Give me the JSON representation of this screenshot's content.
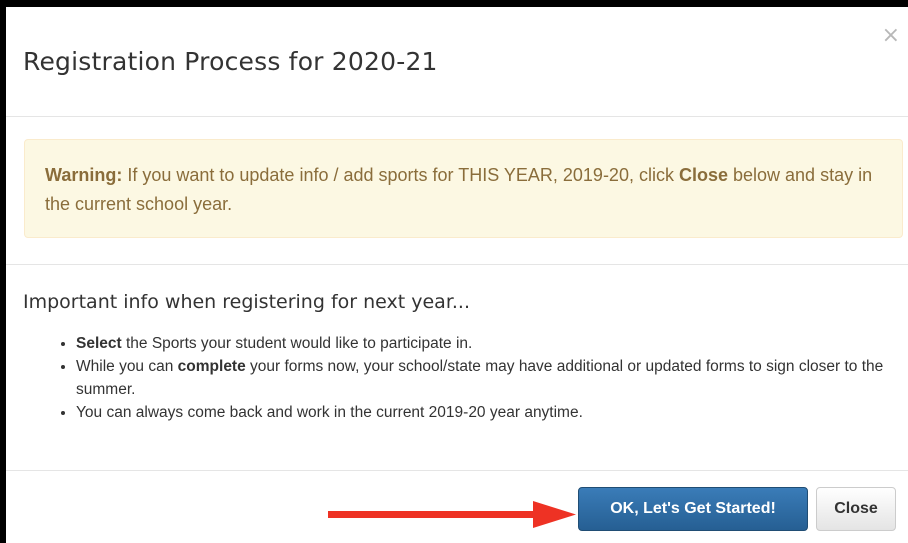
{
  "modal": {
    "title": "Registration Process for 2020-21",
    "close_icon_glyph": "×"
  },
  "warning": {
    "label": "Warning:",
    "text_before": " If you want to update info / add sports for THIS YEAR, 2019-20, click ",
    "close_word": "Close",
    "text_after": " below and stay in the current school year."
  },
  "info": {
    "heading": "Important info when registering for next year...",
    "items": [
      {
        "bold": "Select",
        "text": " the Sports your student would like to participate in."
      },
      {
        "before": "While you can ",
        "bold": "complete",
        "text": " your forms now, your school/state may have additional or updated forms to sign closer to the summer."
      },
      {
        "text": "You can always come back and work in the current 2019-20 year anytime."
      }
    ]
  },
  "footer": {
    "primary_label": "OK, Let's Get Started!",
    "close_label": "Close"
  },
  "colors": {
    "arrow": "#ee3224",
    "primary_button": "#2e6da4",
    "warning_text": "#8a6d3b",
    "warning_bg": "#fcf8e3"
  },
  "icons": {
    "close": "close-icon",
    "arrow": "arrow-right-icon"
  }
}
